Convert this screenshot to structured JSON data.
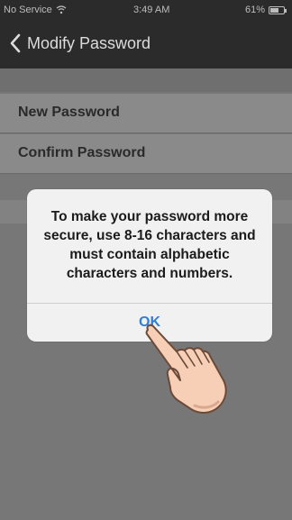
{
  "status_bar": {
    "carrier": "No Service",
    "time": "3:49 AM",
    "battery": "61%",
    "battery_fill": 0.61
  },
  "nav": {
    "title": "Modify Password",
    "back_icon": "chevron-left-icon"
  },
  "form": {
    "rows": [
      {
        "label": "New Password"
      },
      {
        "label": "Confirm Password"
      }
    ]
  },
  "alert": {
    "message": "To make your password more secure, use 8-16 characters and must contain alphabetic characters and numbers.",
    "ok_label": "OK"
  },
  "colors": {
    "accent": "#2f7ed8",
    "nav_bg": "#2b2b2b"
  },
  "icons": [
    "wifi-icon",
    "battery-icon",
    "chevron-left-icon",
    "pointing-hand-icon"
  ]
}
